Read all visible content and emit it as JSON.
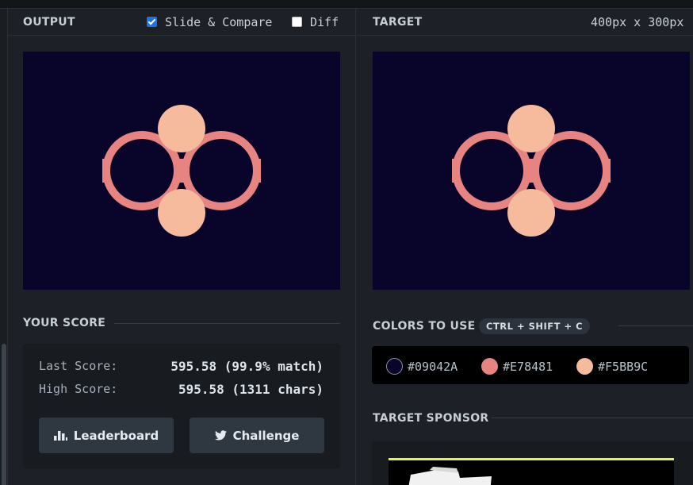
{
  "output": {
    "title": "OUTPUT",
    "slide_compare": {
      "label": "Slide & Compare",
      "checked": true
    },
    "diff": {
      "label": "Diff",
      "checked": false
    }
  },
  "target": {
    "title": "TARGET",
    "dimensions": "400px x 300px"
  },
  "score": {
    "title": "YOUR SCORE",
    "last_label": "Last Score:",
    "last_value": "595.58 (99.9% match)",
    "high_label": "High Score:",
    "high_value": "595.58 (1311 chars)",
    "leaderboard_label": "Leaderboard",
    "challenge_label": "Challenge"
  },
  "colors": {
    "title": "COLORS TO USE",
    "shortcut": "CTRL + SHIFT + C",
    "swatches": [
      {
        "hex": "#09042A",
        "color": "#09042a"
      },
      {
        "hex": "#E78481",
        "color": "#e78481"
      },
      {
        "hex": "#F5BB9C",
        "color": "#f5bb9c"
      }
    ]
  },
  "sponsor": {
    "title": "TARGET SPONSOR"
  },
  "icons": {
    "leaderboard": "bar-chart-icon",
    "challenge": "twitter-icon"
  }
}
